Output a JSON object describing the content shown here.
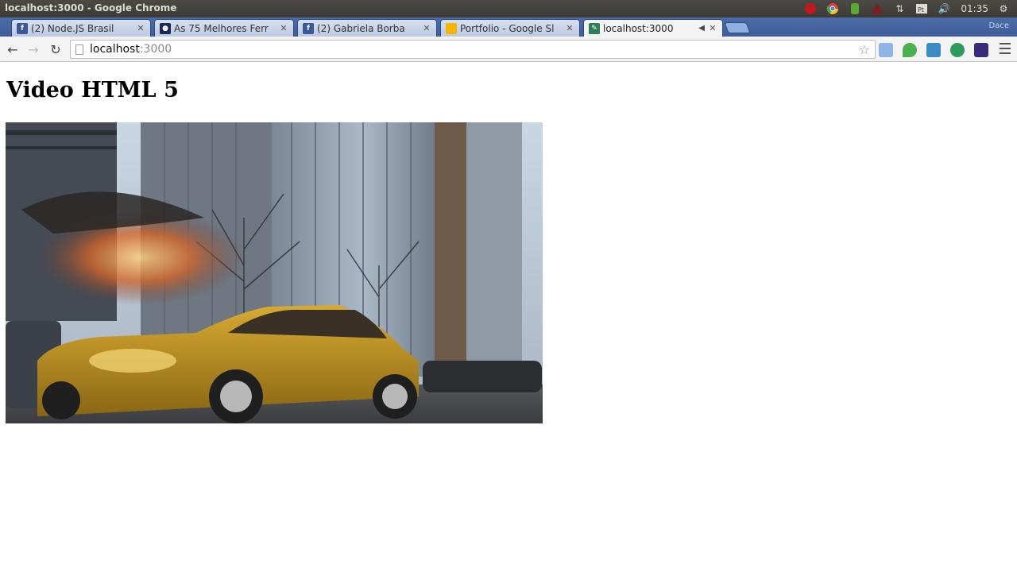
{
  "window": {
    "title": "localhost:3000 - Google Chrome"
  },
  "tray": {
    "clock": "01:35",
    "user": "Dace"
  },
  "tabs": [
    {
      "label": "(2) Node.JS Brasil",
      "favicon": "facebook-icon",
      "active": false
    },
    {
      "label": "As 75 Melhores Ferr",
      "favicon": "site-icon",
      "active": false
    },
    {
      "label": "(2) Gabriela Borba",
      "favicon": "facebook-icon",
      "active": false
    },
    {
      "label": "Portfolio - Google Sl",
      "favicon": "google-slides-icon",
      "active": false
    },
    {
      "label": "localhost:3000",
      "favicon": "page-icon",
      "active": true
    }
  ],
  "toolbar": {
    "url_host": "localhost",
    "url_port": ":3000"
  },
  "page": {
    "heading": "Video HTML 5"
  },
  "colors": {
    "tabstrip": "#4466a8",
    "taxi": "#c79a1e"
  }
}
